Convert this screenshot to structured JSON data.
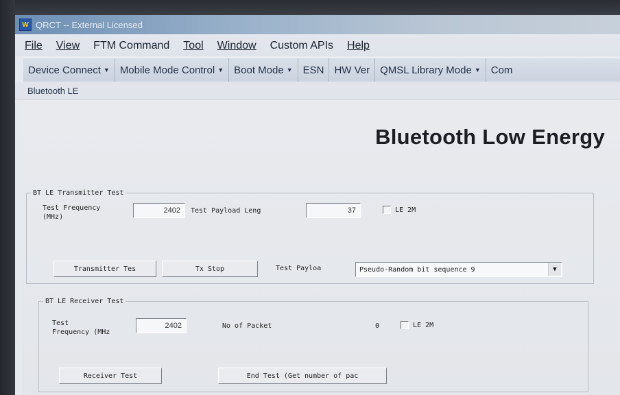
{
  "window": {
    "title": "QRCT -- External Licensed",
    "icon": "qrct-app-icon"
  },
  "menu": [
    {
      "label": "File"
    },
    {
      "label": "View"
    },
    {
      "label": "FTM Command"
    },
    {
      "label": "Tool"
    },
    {
      "label": "Window"
    },
    {
      "label": "Custom APIs"
    },
    {
      "label": "Help"
    }
  ],
  "toolbar": {
    "device_connect": "Device Connect",
    "mobile_mode_control": "Mobile Mode Control",
    "boot_mode": "Boot Mode",
    "esn": "ESN",
    "hw_ver": "HW Ver",
    "qmsl_library_mode": "QMSL Library Mode",
    "truncated": "Com",
    "dropdown_icon": "caret-down-icon"
  },
  "breadcrumb": "Bluetooth LE",
  "page_title": "Bluetooth Low Energy",
  "transmitter": {
    "legend": "BT LE Transmitter Test",
    "freq_label_1": "Test Frequency",
    "freq_label_2": "(MHz)",
    "freq_value": "2402",
    "payload_len_label": "Test Payload Leng",
    "payload_len_value": "37",
    "le2m_label": "LE 2M",
    "le2m_checked": false,
    "start_button": "Transmitter Tes",
    "stop_button": "Tx Stop",
    "payload_label": "Test Payloa",
    "payload_value": "Pseudo-Random bit sequence 9"
  },
  "receiver": {
    "legend": "BT LE Receiver Test",
    "freq_label_1": "Test",
    "freq_label_2": "Frequency (MHz",
    "freq_value": "2402",
    "packets_label": "No  of Packet",
    "packets_value": "0",
    "le2m_label": "LE 2M",
    "le2m_checked": false,
    "start_button": "Receiver Test",
    "end_button": "End Test (Get number of pac"
  }
}
